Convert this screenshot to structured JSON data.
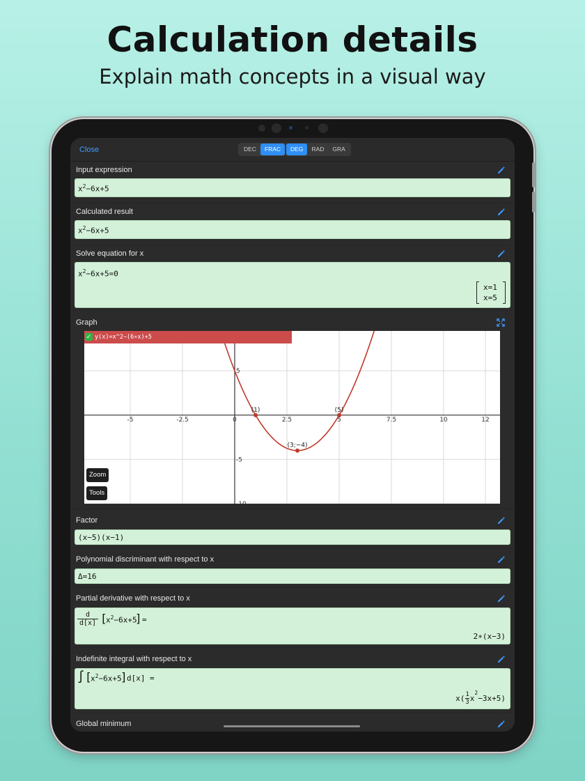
{
  "hero": {
    "title": "Calculation details",
    "subtitle": "Explain math concepts in a visual way"
  },
  "toolbar": {
    "close_label": "Close",
    "modes": [
      "DEC",
      "FRAC",
      "DEG",
      "RAD",
      "GRA"
    ],
    "active_modes": [
      "FRAC",
      "DEG"
    ]
  },
  "sections": {
    "input": {
      "label": "Input expression",
      "base": "x",
      "exp": "2",
      "rest": "−6x+5"
    },
    "result": {
      "label": "Calculated result",
      "base": "x",
      "exp": "2",
      "rest": "−6x+5"
    },
    "solve": {
      "label": "Solve equation for x",
      "base": "x",
      "exp": "2",
      "rest": "−6x+5=0",
      "solutions": [
        "x=1",
        "x=5"
      ]
    },
    "graph": {
      "label": "Graph",
      "legend": "y(x)=x^2−(6∗x)+5",
      "zoom_label": "Zoom",
      "tools_label": "Tools",
      "points": [
        {
          "label": "(1)",
          "x": 1,
          "y": 0
        },
        {
          "label": "(5)",
          "x": 5,
          "y": 0
        },
        {
          "label": "(3;−4)",
          "x": 3,
          "y": -4
        }
      ]
    },
    "factor": {
      "label": "Factor",
      "value": "(x−5)(x−1)"
    },
    "discriminant": {
      "label": "Polynomial discriminant with respect to x",
      "value": "Δ=16"
    },
    "derivative": {
      "label": "Partial derivative with respect to x",
      "num": "d",
      "den": "d[x]",
      "base": "x",
      "exp": "2",
      "rest": "−6x+5",
      "eq": "=",
      "result": "2∗(x−3)"
    },
    "integral": {
      "label": "Indefinite integral with respect to x",
      "sign": "∫",
      "base": "x",
      "exp": "2",
      "rest": "−6x+5",
      "dx": "d[x]",
      "eq": "=",
      "result_prefix": "x(",
      "frac_num": "1",
      "frac_den": "3",
      "result_base": "x",
      "result_exp": "2",
      "result_suffix": "−3x+5)"
    },
    "minimum": {
      "label": "Global minimum"
    }
  },
  "chart_data": {
    "type": "line",
    "series": [
      {
        "name": "y(x)=x^2−(6∗x)+5",
        "color": "#c0392b"
      }
    ],
    "x_ticks": [
      "-5",
      "-2.5",
      "0",
      "2.5",
      "5",
      "7.5",
      "10",
      "12"
    ],
    "y_ticks": [
      "5",
      "-5",
      "-10"
    ],
    "xlim": [
      -7.2,
      12.7
    ],
    "ylim": [
      -10,
      9.5
    ],
    "grid": true
  },
  "colors": {
    "accent": "#2f8ff5",
    "result_bg": "#d3f1d8",
    "curve": "#c0392b",
    "legend_bg": "#cc4b4b"
  }
}
